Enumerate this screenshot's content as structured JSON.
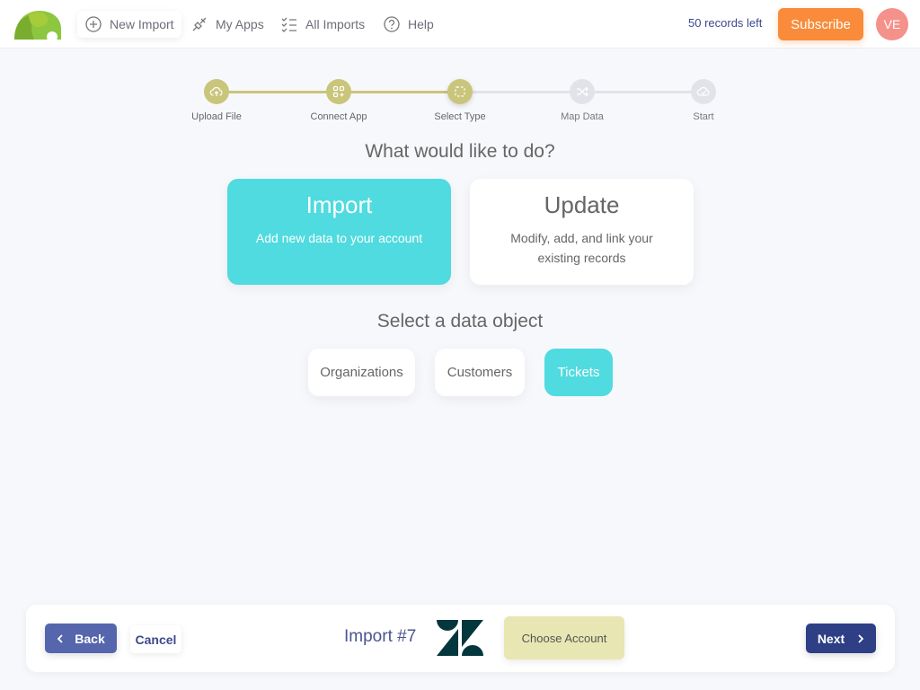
{
  "header": {
    "logo": "elephant-logo",
    "nav": [
      {
        "label": "New Import",
        "icon": "plus-circle-icon",
        "active": true
      },
      {
        "label": "My Apps",
        "icon": "plug-icon",
        "active": false
      },
      {
        "label": "All Imports",
        "icon": "checklist-icon",
        "active": false
      },
      {
        "label": "Help",
        "icon": "question-icon",
        "active": false
      }
    ],
    "records_left": "50 records left",
    "subscribe_label": "Subscribe",
    "avatar_initials": "VE"
  },
  "stepper": {
    "steps": [
      {
        "label": "Upload File",
        "icon": "cloud-upload-icon",
        "status": "done"
      },
      {
        "label": "Connect App",
        "icon": "apps-add-icon",
        "status": "done"
      },
      {
        "label": "Select Type",
        "icon": "dashed-square-icon",
        "status": "current"
      },
      {
        "label": "Map Data",
        "icon": "shuffle-icon",
        "status": "pending"
      },
      {
        "label": "Start",
        "icon": "cloud-check-icon",
        "status": "pending"
      }
    ]
  },
  "main": {
    "question": "What would like to do?",
    "choices": [
      {
        "title": "Import",
        "description": "Add new data to your account",
        "selected": true
      },
      {
        "title": "Update",
        "description": "Modify, add, and link your existing records",
        "selected": false
      }
    ],
    "object_title": "Select a data object",
    "objects": [
      {
        "label": "Organizations",
        "selected": false
      },
      {
        "label": "Customers",
        "selected": false
      },
      {
        "label": "Tickets",
        "selected": true
      }
    ]
  },
  "footer": {
    "back_label": "Back",
    "cancel_label": "Cancel",
    "import_name": "Import #7",
    "app_logo": "zendesk-logo",
    "choose_account_label": "Choose Account",
    "next_label": "Next"
  },
  "colors": {
    "accent_teal": "#4fdbdf",
    "step_done": "#c9c57a",
    "subscribe_orange": "#f98b3a",
    "back_blue": "#5566ad",
    "next_navy": "#2e3f85"
  }
}
